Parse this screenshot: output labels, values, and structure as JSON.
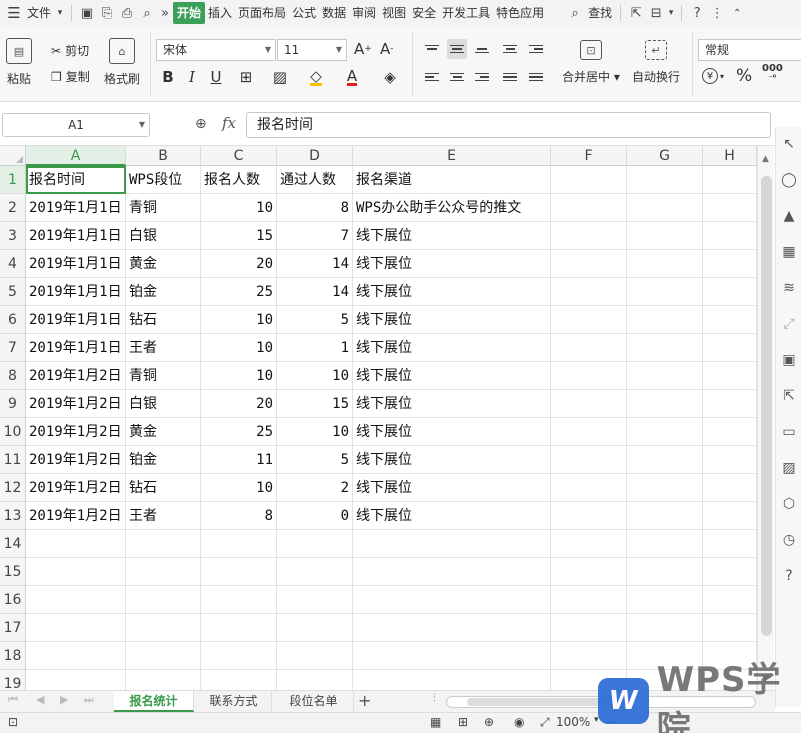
{
  "menu": {
    "file": "文件",
    "tabs": [
      "开始",
      "插入",
      "页面布局",
      "公式",
      "数据",
      "审阅",
      "视图",
      "安全",
      "开发工具",
      "特色应用"
    ],
    "active_tab": "开始",
    "search": "查找"
  },
  "ribbon": {
    "paste": "粘贴",
    "cut": "剪切",
    "copy": "复制",
    "format_painter": "格式刷",
    "font_name": "宋体",
    "font_size": "11",
    "bold": "B",
    "italic": "I",
    "underline": "U",
    "merge_center": "合并居中",
    "wrap_text": "自动换行",
    "number_format": "常规",
    "currency": "¥",
    "percent": "%",
    "thousands": "000",
    "font_grow": "A+",
    "font_shrink": "A-"
  },
  "formula_bar": {
    "cell_ref": "A1",
    "fx": "fx",
    "content": "报名时间"
  },
  "grid": {
    "columns": [
      "A",
      "B",
      "C",
      "D",
      "E",
      "F",
      "G",
      "H"
    ],
    "rows": [
      "1",
      "2",
      "3",
      "4",
      "5",
      "6",
      "7",
      "8",
      "9",
      "10",
      "11",
      "12",
      "13",
      "14",
      "15",
      "16",
      "17",
      "18",
      "19"
    ],
    "header": [
      "报名时间",
      "WPS段位",
      "报名人数",
      "通过人数",
      "报名渠道"
    ],
    "data": [
      [
        "2019年1月1日",
        "青铜",
        "10",
        "8",
        "WPS办公助手公众号的推文"
      ],
      [
        "2019年1月1日",
        "白银",
        "15",
        "7",
        "线下展位"
      ],
      [
        "2019年1月1日",
        "黄金",
        "20",
        "14",
        "线下展位"
      ],
      [
        "2019年1月1日",
        "铂金",
        "25",
        "14",
        "线下展位"
      ],
      [
        "2019年1月1日",
        "钻石",
        "10",
        "5",
        "线下展位"
      ],
      [
        "2019年1月1日",
        "王者",
        "10",
        "1",
        "线下展位"
      ],
      [
        "2019年1月2日",
        "青铜",
        "10",
        "10",
        "线下展位"
      ],
      [
        "2019年1月2日",
        "白银",
        "20",
        "15",
        "线下展位"
      ],
      [
        "2019年1月2日",
        "黄金",
        "25",
        "10",
        "线下展位"
      ],
      [
        "2019年1月2日",
        "铂金",
        "11",
        "5",
        "线下展位"
      ],
      [
        "2019年1月2日",
        "钻石",
        "10",
        "2",
        "线下展位"
      ],
      [
        "2019年1月2日",
        "王者",
        "8",
        "0",
        "线下展位"
      ]
    ]
  },
  "sheets": {
    "tabs": [
      "报名统计",
      "联系方式",
      "段位名单"
    ],
    "active": "报名统计",
    "add": "+"
  },
  "status": {
    "zoom": "100%"
  },
  "watermark": {
    "logo": "W",
    "text": "WPS学院"
  },
  "colors": {
    "accent": "#3a9a4a",
    "active_tab_bg": "#3aa05a",
    "watermark_blue": "#2b6bd6"
  }
}
